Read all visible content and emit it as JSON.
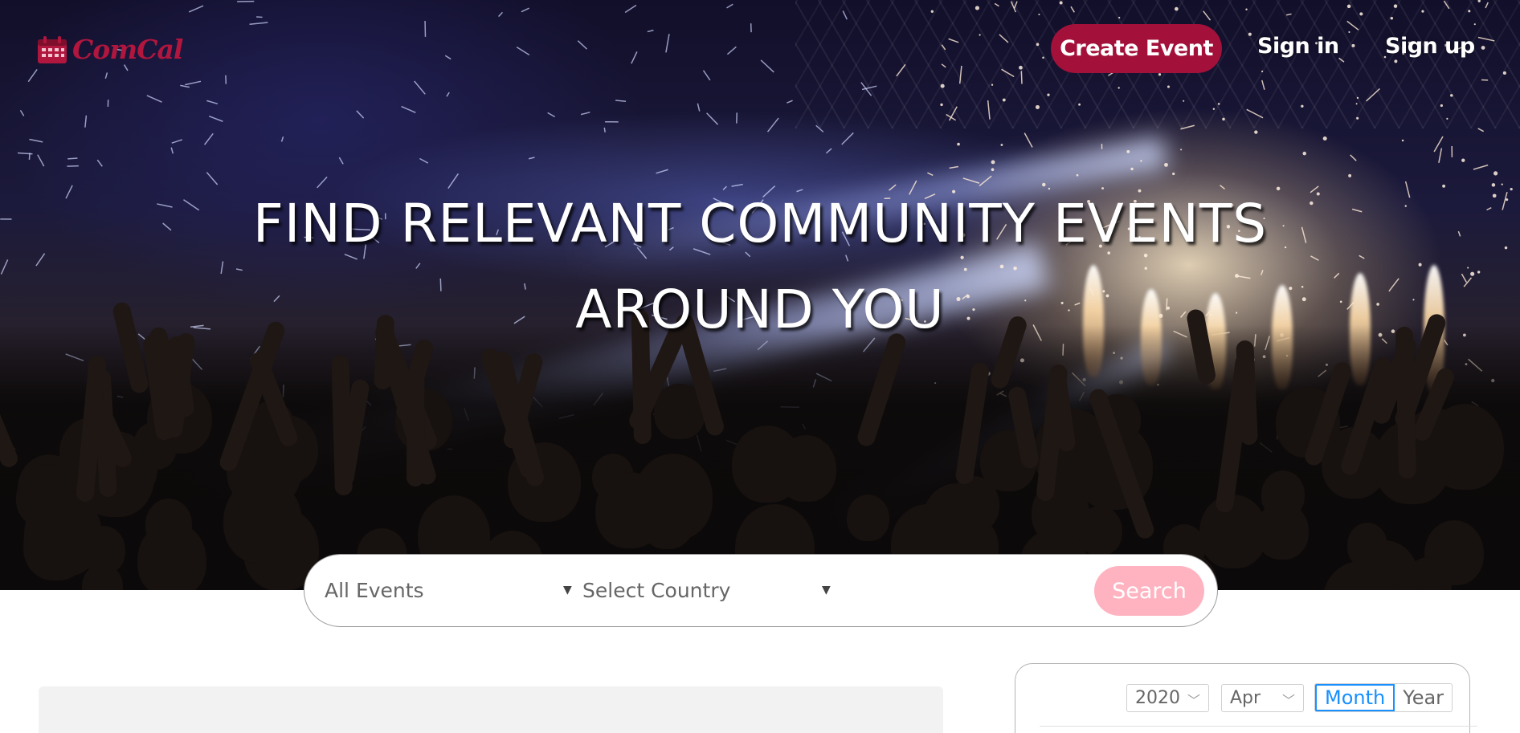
{
  "header": {
    "logo_text": "ComCal",
    "logo_icon": "calendar-icon",
    "create_event_label": "Create Event",
    "sign_in_label": "Sign in",
    "sign_up_label": "Sign up"
  },
  "hero": {
    "headline_line1": "FIND RELEVANT COMMUNITY EVENTS",
    "headline_line2": "AROUND YOU"
  },
  "search": {
    "events_select_value": "All Events",
    "country_select_value": "Select Country",
    "button_label": "Search"
  },
  "calendar": {
    "year_value": "2020",
    "month_value": "Apr",
    "mode_month_label": "Month",
    "mode_year_label": "Year",
    "active_mode": "Month"
  },
  "colors": {
    "brand": "#a3113b",
    "logo": "#b0163e",
    "search_button": "#ffb3c0",
    "calendar_accent": "#1890ff"
  }
}
